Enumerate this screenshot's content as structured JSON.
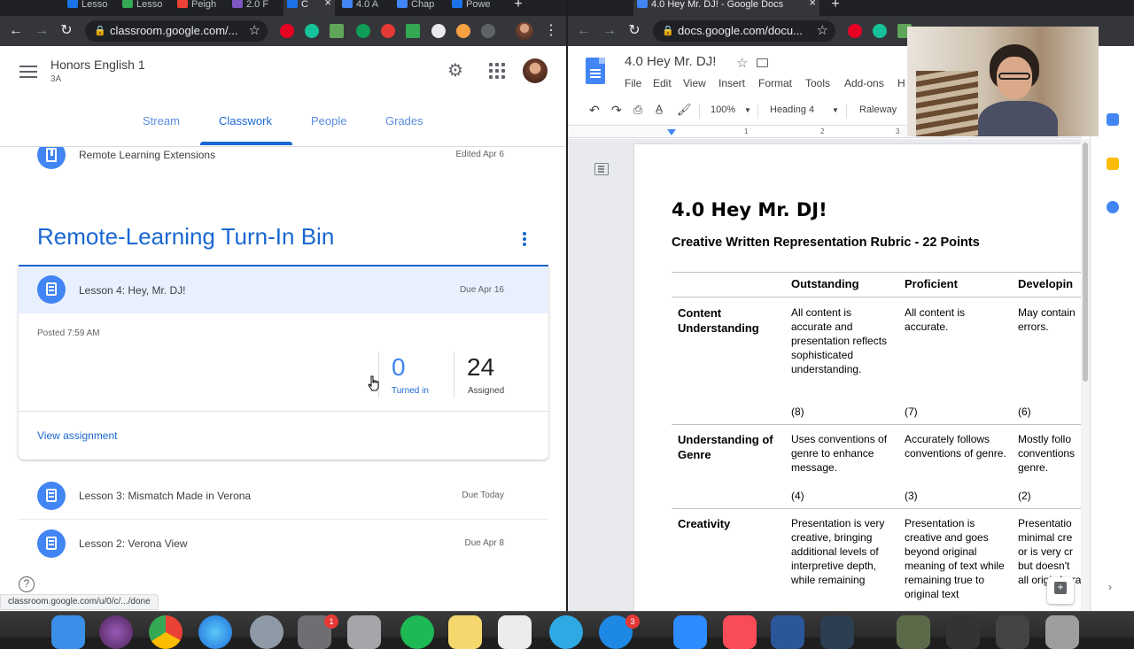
{
  "left_browser": {
    "tabs": [
      {
        "label": "Lesso",
        "color": "#1a73e8"
      },
      {
        "label": "Lesso",
        "color": "#34a853"
      },
      {
        "label": "Peigh",
        "color": "#ea4335"
      },
      {
        "label": "2.0 F",
        "color": "#7e57c2"
      },
      {
        "label": "C",
        "color": "#1a73e8",
        "active": true
      },
      {
        "label": "4.0 A",
        "color": "#4285f4"
      },
      {
        "label": "Chap",
        "color": "#4285f4"
      },
      {
        "label": "Powe",
        "color": "#1a73e8"
      }
    ],
    "new_tab": "+",
    "url": "classroom.google.com/..."
  },
  "classroom": {
    "class_title": "Honors English 1",
    "class_section": "3A",
    "tabs": [
      "Stream",
      "Classwork",
      "People",
      "Grades"
    ],
    "active_tab": "Classwork",
    "top_item": {
      "title": "Remote Learning Extensions",
      "meta": "Edited Apr 6"
    },
    "topic": "Remote-Learning Turn-In Bin",
    "expanded": {
      "title": "Lesson 4: Hey, Mr. DJ!",
      "due": "Due Apr 16",
      "posted": "Posted 7:59 AM",
      "turned_in_count": "0",
      "turned_in_label": "Turned in",
      "assigned_count": "24",
      "assigned_label": "Assigned",
      "view_link": "View assignment"
    },
    "items": [
      {
        "title": "Lesson 3: Mismatch Made in Verona",
        "due": "Due Today"
      },
      {
        "title": "Lesson 2: Verona View",
        "due": "Due Apr 8"
      }
    ],
    "help": "?",
    "status_url": "classroom.google.com/u/0/c/.../done",
    "accent": "#1967d2"
  },
  "right_browser": {
    "tab_title": "4.0 Hey Mr. DJ! - Google Docs",
    "tab_close": "×",
    "new_tab": "+",
    "url": "docs.google.com/docu..."
  },
  "docs": {
    "title": "4.0 Hey Mr. DJ!",
    "menu": [
      "File",
      "Edit",
      "View",
      "Insert",
      "Format",
      "Tools",
      "Add-ons",
      "H"
    ],
    "zoom": "100%",
    "style": "Heading 4",
    "font": "Raleway",
    "ruler": [
      "1",
      "2",
      "3"
    ],
    "heading": "4.0 Hey Mr. DJ!",
    "subheading": "Creative Written Representation Rubric - 22 Points",
    "rubric": {
      "columns": [
        "Outstanding",
        "Proficient",
        "Developin"
      ],
      "rows": [
        {
          "criterion": "Content Understanding",
          "cells": [
            "All content is accurate and presentation reflects sophisticated understanding.",
            "All content is accurate.",
            "May contain errors."
          ],
          "points": [
            "(8)",
            "(7)",
            "(6)"
          ]
        },
        {
          "criterion": "Understanding of Genre",
          "cells": [
            "Uses conventions of genre to enhance message.",
            "Accurately follows conventions of genre.",
            "Mostly follo conventions genre."
          ],
          "points": [
            "(4)",
            "(3)",
            "(2)"
          ]
        },
        {
          "criterion": "Creativity",
          "cells": [
            "Presentation is very creative, bringing additional levels of interpretive depth, while remaining",
            "Presentation is creative and goes beyond original meaning of text while remaining true to original text",
            "Presentatio minimal cre or is very cr but doesn't all origi chara"
          ],
          "points": []
        }
      ]
    }
  },
  "dock": {
    "badges": [
      "1",
      "3"
    ]
  }
}
